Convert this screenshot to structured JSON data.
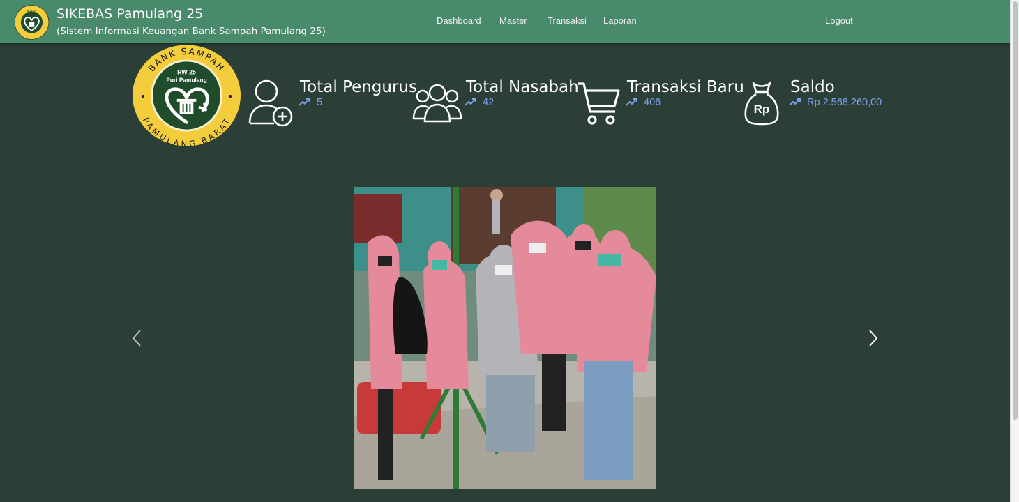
{
  "app": {
    "title": "SIKEBAS Pamulang 25",
    "subtitle": "(Sistem Informasi Keuangan Bank Sampah Pamulang 25)"
  },
  "logo": {
    "ring_top": "BANK SAMPAH",
    "ring_bottom": "PAMULANG BARAT",
    "line1": "RW 25",
    "line2": "Puri Pamulang"
  },
  "nav": {
    "dashboard": "Dashboard",
    "master": "Master",
    "transaksi": "Transaksi",
    "laporan": "Laporan",
    "logout": "Logout"
  },
  "stats": [
    {
      "label": "Total Pengurus",
      "value": "5",
      "icon": "user-add-icon"
    },
    {
      "label": "Total Nasabah",
      "value": "42",
      "icon": "users-icon"
    },
    {
      "label": "Transaksi Baru",
      "value": "406",
      "icon": "cart-icon"
    },
    {
      "label": "Saldo",
      "value": "Rp 2.568.260,00",
      "icon": "money-bag-icon",
      "bag_text": "Rp"
    }
  ],
  "colors": {
    "navbar": "#4a8a6c",
    "background": "#2b3f37",
    "stat_value": "#7ba3ea",
    "logo_yellow": "#f4cd3c",
    "logo_green": "#1f4d2c"
  }
}
